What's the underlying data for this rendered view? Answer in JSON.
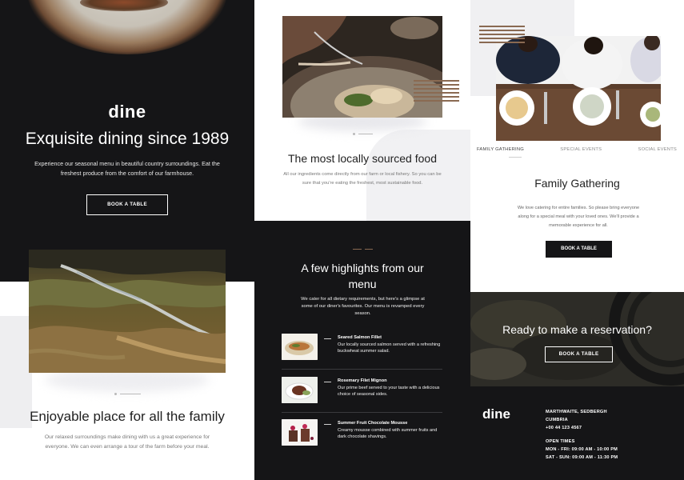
{
  "hero": {
    "logo": "dine",
    "title": "Exquisite dining since 1989",
    "description": "Experience our seasonal menu in beautiful country surroundings. Eat the freshest produce from the comfort of our farmhouse.",
    "button": "BOOK A TABLE"
  },
  "family_section": {
    "title": "Enjoyable place for all the family",
    "description": "Our relaxed surroundings make dining with us a great experience for everyone. We can even arrange a tour of the farm before your meal."
  },
  "local_section": {
    "title": "The most locally sourced food",
    "description": "All our ingredients come directly from our farm or local fishery. So you can be sure that you're eating the freshest, most sustainable food."
  },
  "highlights": {
    "title": "A few highlights from our menu",
    "description": "We cater for all dietary requirements, but here's a glimpse at some of our diner's favourites. Our menu is revamped every season.",
    "items": [
      {
        "name": "Seared Salmon Fillet",
        "description": "Our locally sourced salmon served with a refreshing buckwheat summer salad."
      },
      {
        "name": "Rosemary Filet Mignon",
        "description": "Our prime beef served to your taste with a delicious choice of seasonal sides."
      },
      {
        "name": "Summer Fruit Chocolate Mousse",
        "description": "Creamy mousse combined with summer fruits and dark chocolate shavings."
      }
    ]
  },
  "events": {
    "tabs": [
      "FAMILY GATHERING",
      "SPECIAL EVENTS",
      "SOCIAL EVENTS"
    ],
    "title": "Family Gathering",
    "description": "We love catering for entire families. So please bring everyone along for a special meal with your loved ones. We'll provide a memorable experience for all.",
    "button": "BOOK A TABLE"
  },
  "reservation": {
    "title": "Ready to make a reservation?",
    "button": "BOOK A TABLE"
  },
  "footer": {
    "logo": "dine",
    "address_line1": "MARTHWAITE, SEDBERGH",
    "address_line2": "CUMBRIA",
    "phone": "+00 44 123 4567",
    "hours_title": "OPEN TIMES",
    "hours_weekday": "MON - FRI: 09:00 AM - 10:00 PM",
    "hours_weekend": "SAT - SUN: 09:00 AM - 11:30 PM"
  },
  "colors": {
    "dark": "#151517",
    "accent_brown": "#8a6a52",
    "grey_panel": "#f0f0f2"
  }
}
